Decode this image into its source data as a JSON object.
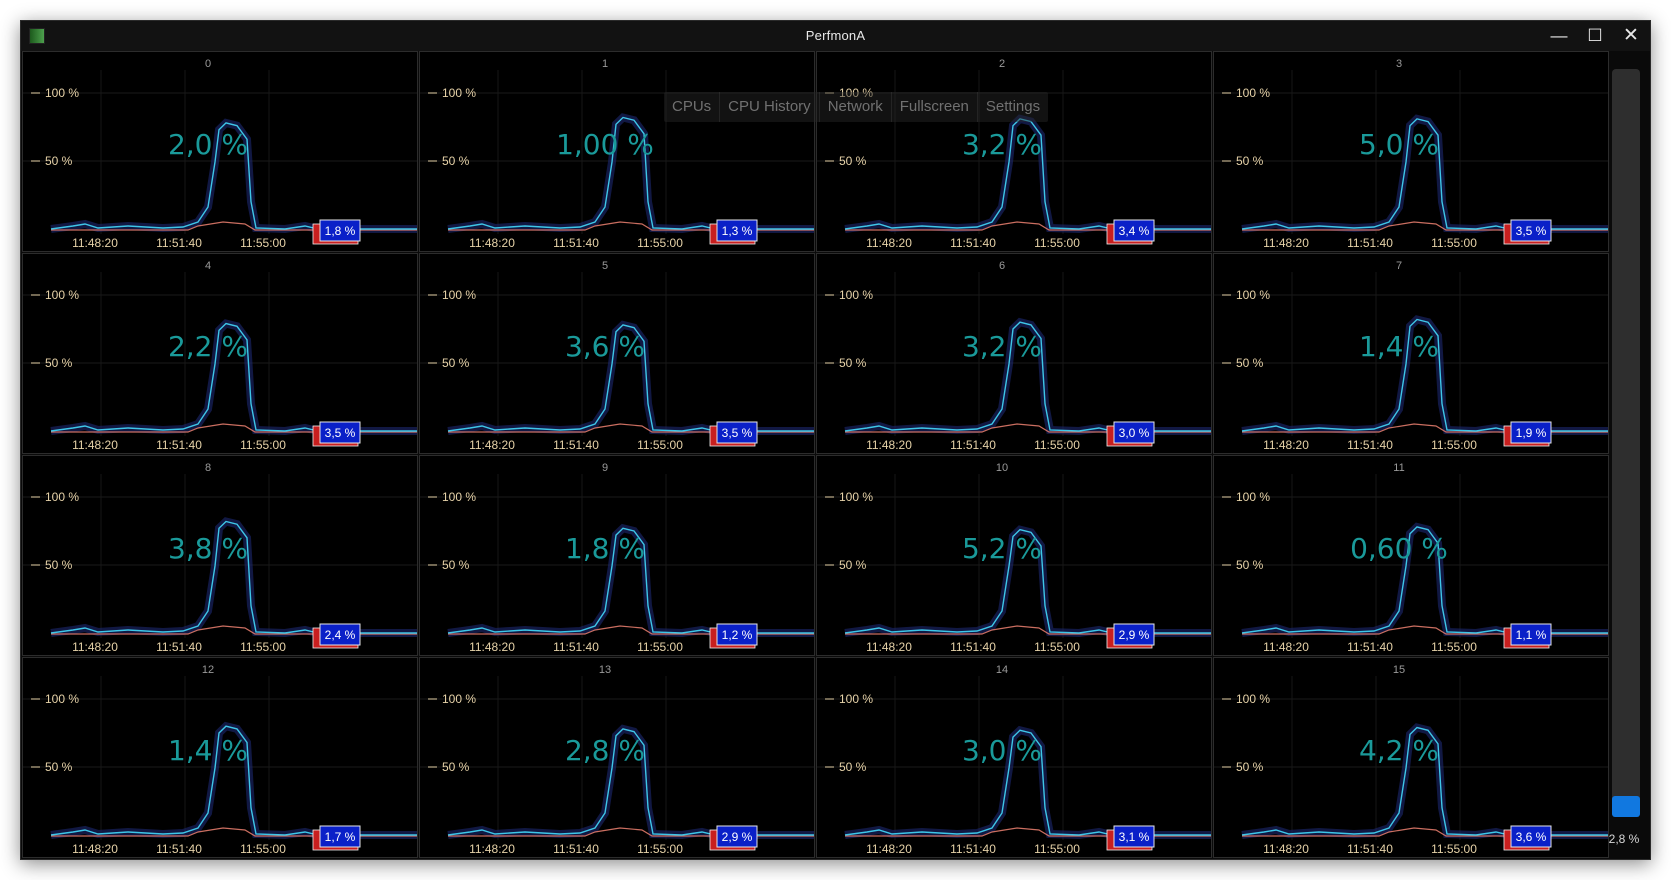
{
  "window": {
    "title": "PerfmonA",
    "controls": {
      "minimize": "—",
      "maximize": "☐",
      "close": "✕"
    }
  },
  "tabs": [
    "CPUs",
    "CPU History",
    "Network",
    "Fullscreen",
    "Settings"
  ],
  "axis": {
    "top_label": "100 %",
    "mid_label": "50 %",
    "time_labels": [
      "11:48:20",
      "11:51:40",
      "11:55:00"
    ]
  },
  "colors": {
    "usage_line": "#3ec6e8",
    "red_line": "#e07a6a",
    "big_text": "#1a9a9a",
    "badge_bg": "#0a20c8",
    "badge_border": "#e6e6e6",
    "badge_red": "#c81f1f",
    "scale_fill": "#1178e0",
    "axis_text": "#e6d2a8"
  },
  "cpus": [
    {
      "index": "0",
      "usage": "2,0 %",
      "current": "1,8 %",
      "peak": 78
    },
    {
      "index": "1",
      "usage": "1,00 %",
      "current": "1,3 %",
      "peak": 82
    },
    {
      "index": "2",
      "usage": "3,2 %",
      "current": "3,4 %",
      "peak": 81
    },
    {
      "index": "3",
      "usage": "5,0 %",
      "current": "3,5 %",
      "peak": 81
    },
    {
      "index": "4",
      "usage": "2,2 %",
      "current": "3,5 %",
      "peak": 79
    },
    {
      "index": "5",
      "usage": "3,6 %",
      "current": "3,5 %",
      "peak": 78
    },
    {
      "index": "6",
      "usage": "3,2 %",
      "current": "3,0 %",
      "peak": 80
    },
    {
      "index": "7",
      "usage": "1,4 %",
      "current": "1,9 %",
      "peak": 82
    },
    {
      "index": "8",
      "usage": "3,8 %",
      "current": "2,4 %",
      "peak": 82
    },
    {
      "index": "9",
      "usage": "1,8 %",
      "current": "1,2 %",
      "peak": 77
    },
    {
      "index": "10",
      "usage": "5,2 %",
      "current": "2,9 %",
      "peak": 76
    },
    {
      "index": "11",
      "usage": "0,60 %",
      "current": "1,1 %",
      "peak": 78
    },
    {
      "index": "12",
      "usage": "1,4 %",
      "current": "1,7 %",
      "peak": 80
    },
    {
      "index": "13",
      "usage": "2,8 %",
      "current": "2,9 %",
      "peak": 78
    },
    {
      "index": "14",
      "usage": "3,0 %",
      "current": "3,1 %",
      "peak": 77
    },
    {
      "index": "15",
      "usage": "4,2 %",
      "current": "3,6 %",
      "peak": 79
    }
  ],
  "total": {
    "label": "2,8 %",
    "fraction": 0.028
  }
}
